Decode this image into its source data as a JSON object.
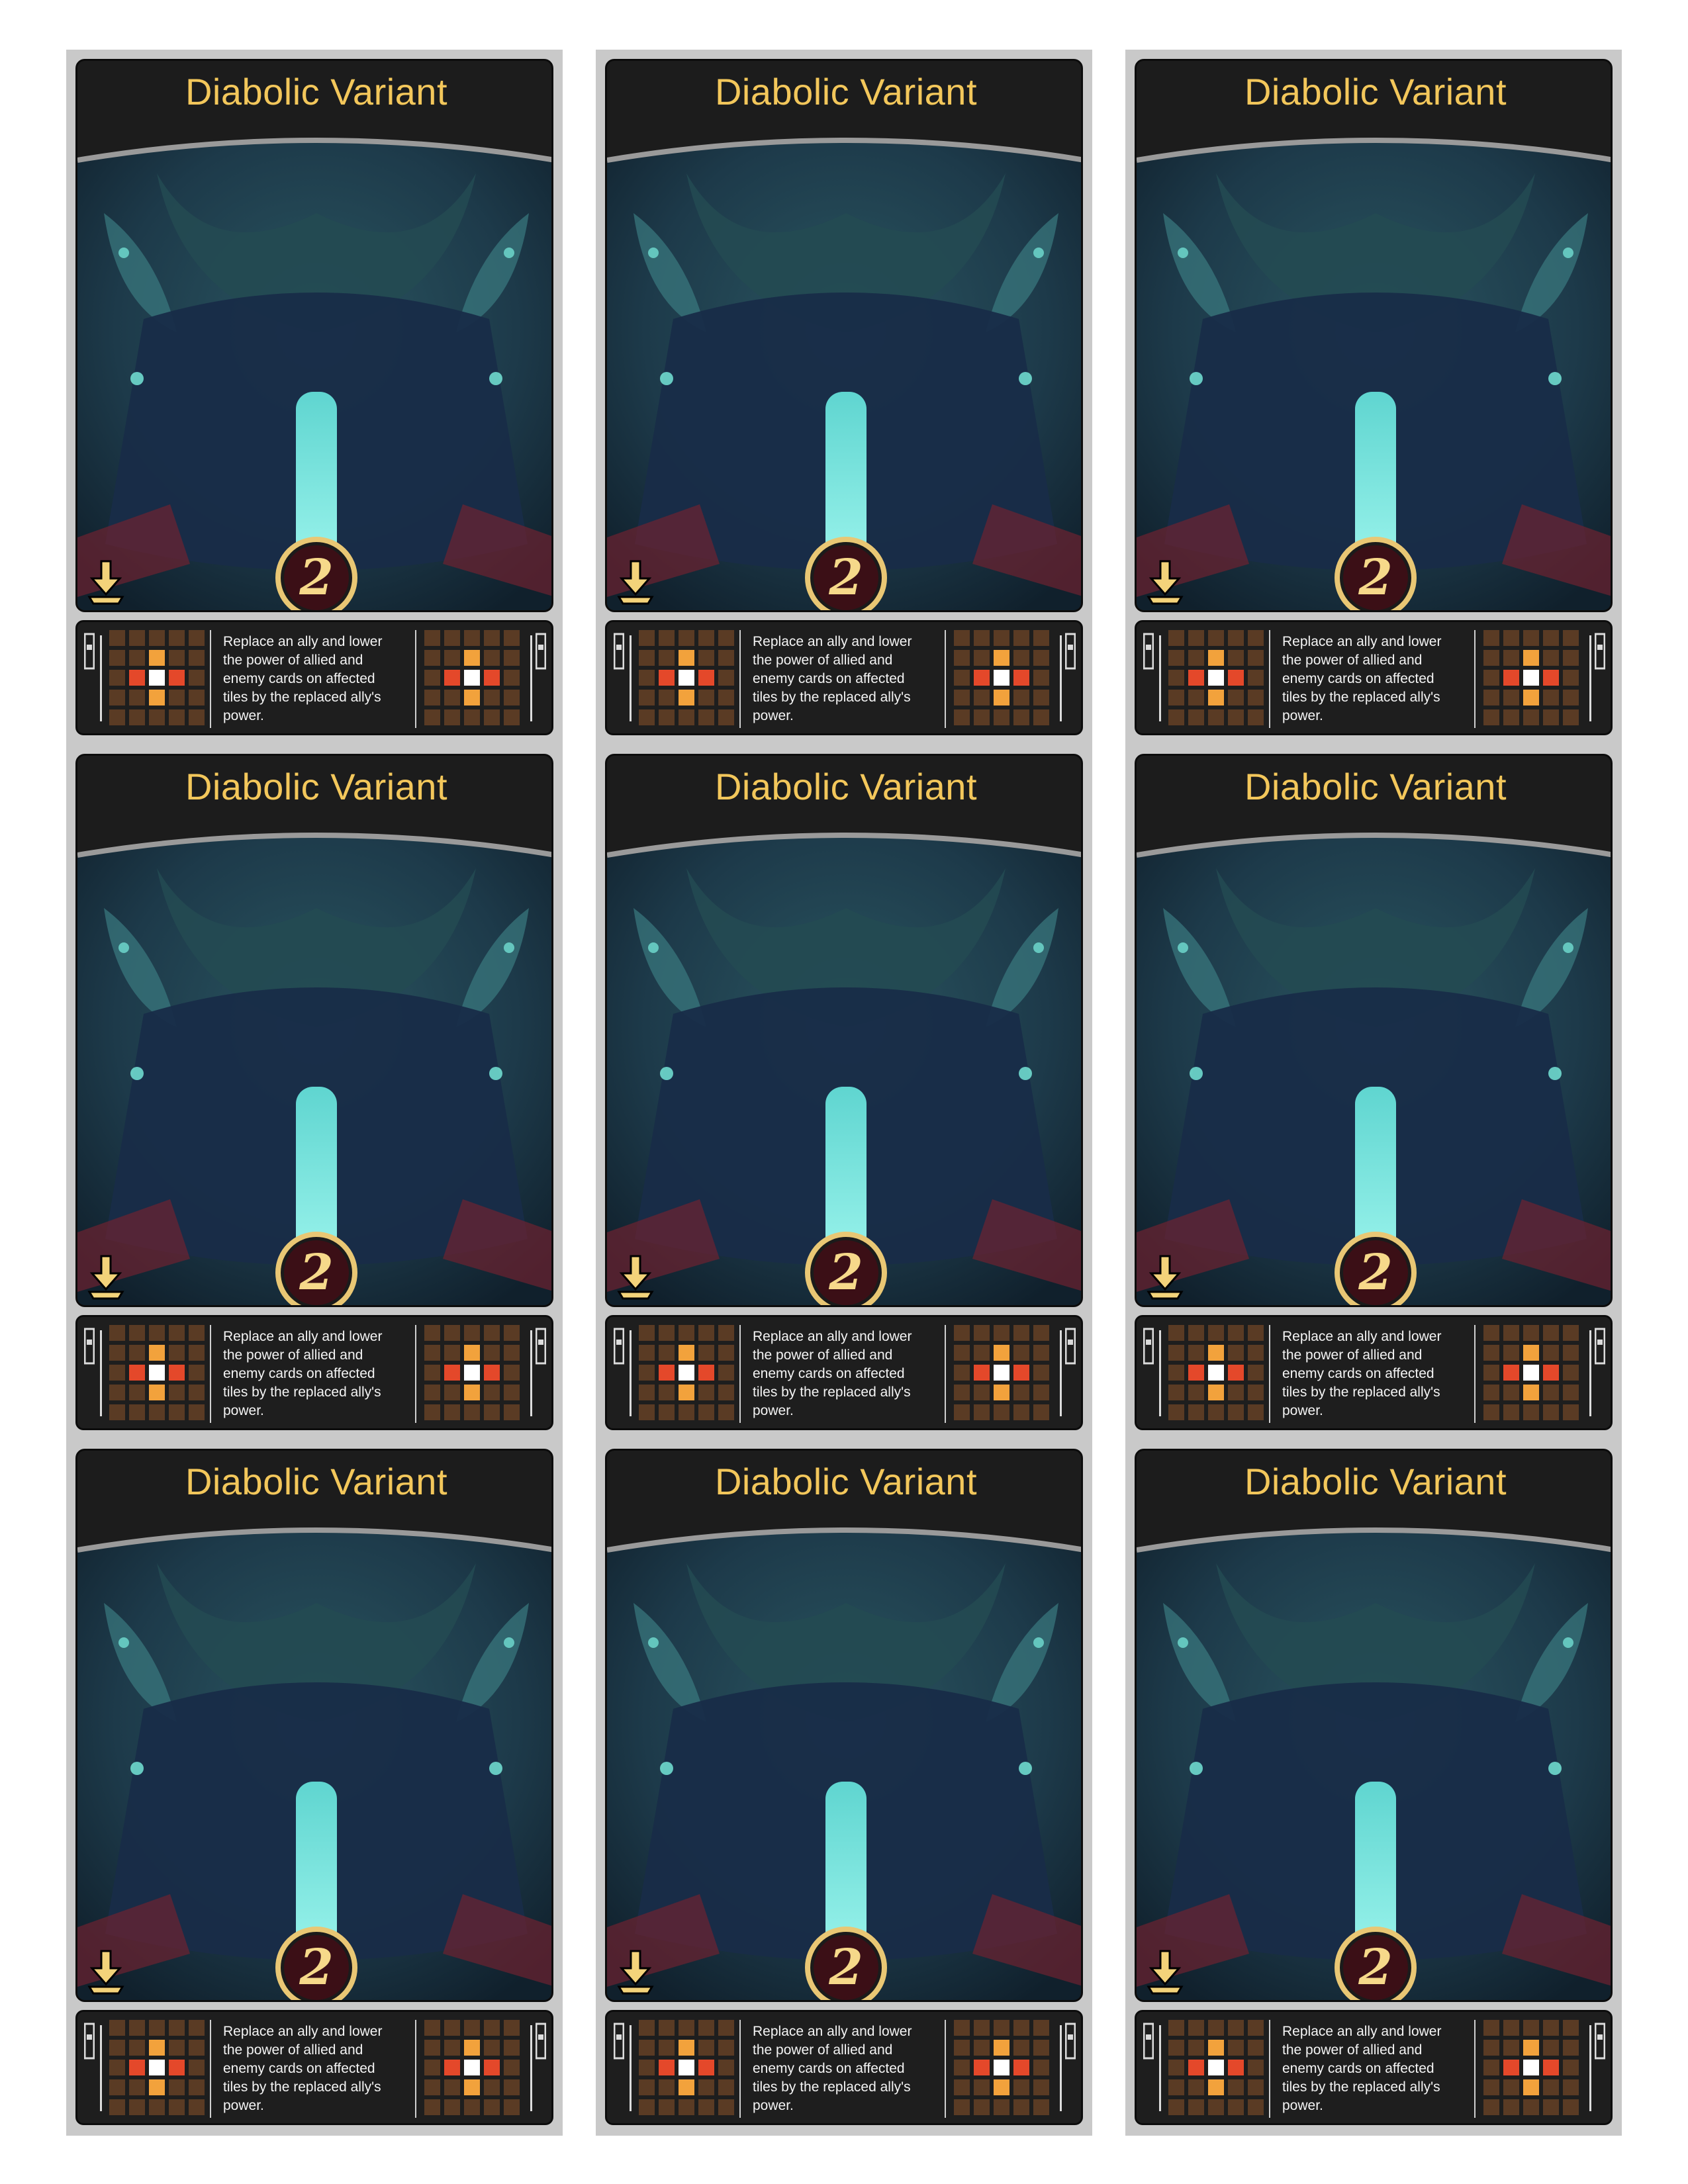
{
  "card": {
    "title": "Diabolic Variant",
    "power": "2",
    "description": "Replace an ally and lower the power of allied and enemy cards on affected tiles by the replaced ally's power.",
    "play_icon": "down-arrow-hand-icon",
    "side_icon": "card-stack-icon",
    "colors": {
      "title": "#f3c75b",
      "frame": "#1c1c1c",
      "badge": "#3b0f16",
      "badge_ring": "#e9c774",
      "cell_empty": "#5a3b24",
      "cell_orange": "#f2a23c",
      "cell_red": "#e4482a",
      "cell_center": "#ffffff"
    },
    "pattern_left": [
      [
        "e",
        "e",
        "e",
        "e",
        "e"
      ],
      [
        "e",
        "e",
        "o",
        "e",
        "e"
      ],
      [
        "e",
        "r",
        "w",
        "r",
        "e"
      ],
      [
        "e",
        "e",
        "o",
        "e",
        "e"
      ],
      [
        "e",
        "e",
        "e",
        "e",
        "e"
      ]
    ],
    "pattern_right": [
      [
        "e",
        "e",
        "e",
        "e",
        "e"
      ],
      [
        "e",
        "e",
        "o",
        "e",
        "e"
      ],
      [
        "e",
        "r",
        "w",
        "r",
        "e"
      ],
      [
        "e",
        "e",
        "o",
        "e",
        "e"
      ],
      [
        "e",
        "e",
        "e",
        "e",
        "e"
      ]
    ]
  },
  "sheet": {
    "count": 9
  }
}
